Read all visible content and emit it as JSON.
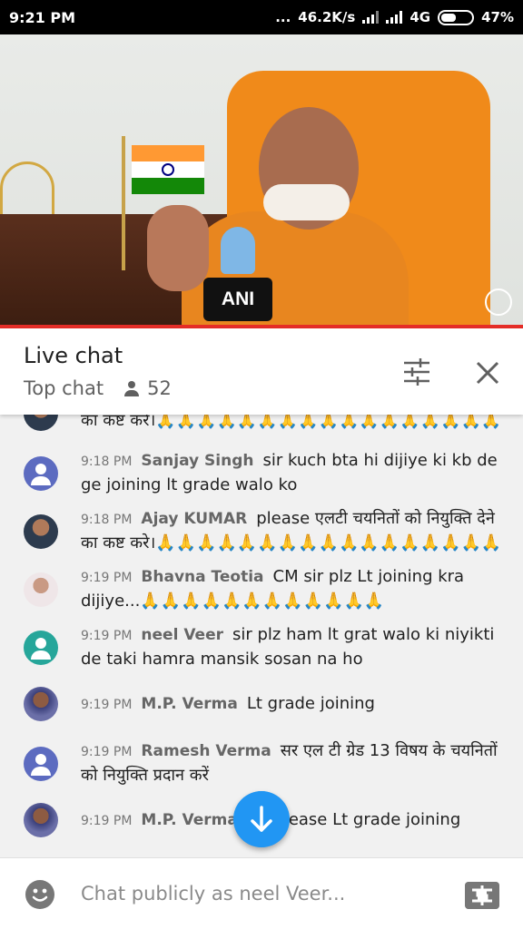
{
  "status_bar": {
    "time": "9:21 PM",
    "dots": "...",
    "speed": "46.2K/s",
    "network": "4G",
    "battery": "47%"
  },
  "video": {
    "mic_label": "ANI",
    "progress_fraction": 1.0,
    "colors": {
      "progress": "#e52d27",
      "robe": "#e8861f"
    }
  },
  "chat_header": {
    "title": "Live chat",
    "mode": "Top chat",
    "viewer_count": "52"
  },
  "messages": [
    {
      "time": "",
      "author": "",
      "text": "का कष्ट करे।🙏🙏🙏🙏🙏🙏🙏🙏🙏🙏🙏🙏🙏🙏🙏🙏🙏",
      "avatar": "photo"
    },
    {
      "time": "9:18 PM",
      "author": "Sanjay Singh",
      "text": "sir kuch bta hi dijiye ki kb de ge joining lt grade walo ko",
      "avatar": "default"
    },
    {
      "time": "9:18 PM",
      "author": "Ajay KUMAR",
      "text": "please एलटी चयनितों को नियुक्ति देने का कष्ट करे।🙏🙏🙏🙏🙏🙏🙏🙏🙏🙏🙏🙏🙏🙏🙏🙏🙏",
      "avatar": "photo"
    },
    {
      "time": "9:19 PM",
      "author": "Bhavna Teotia",
      "text": "CM sir plz Lt joining kra dijiye...🙏🙏🙏🙏🙏🙏🙏🙏🙏🙏🙏🙏",
      "avatar": "photo2"
    },
    {
      "time": "9:19 PM",
      "author": "neel Veer",
      "text": "sir plz ham lt grat walo ki niyikti de taki hamra mansik sosan na ho",
      "avatar": "teal"
    },
    {
      "time": "9:19 PM",
      "author": "M.P. Verma",
      "text": "Lt grade joining",
      "avatar": "photo3"
    },
    {
      "time": "9:19 PM",
      "author": "Ramesh Verma",
      "text": "सर एल टी ग्रेड 13 विषय के चयनितों को नियुक्ति प्रदान करें",
      "avatar": "default"
    },
    {
      "time": "9:19 PM",
      "author": "M.P. Verma",
      "text": "Sir please Lt grade joining",
      "avatar": "photo3"
    }
  ],
  "input": {
    "placeholder": "Chat publicly as neel Veer..."
  },
  "icons": {
    "filter": "sliders-icon",
    "close": "close-icon",
    "emoji": "emoji-icon",
    "scroll": "arrow-down-icon",
    "superchat": "super-chat-icon"
  }
}
